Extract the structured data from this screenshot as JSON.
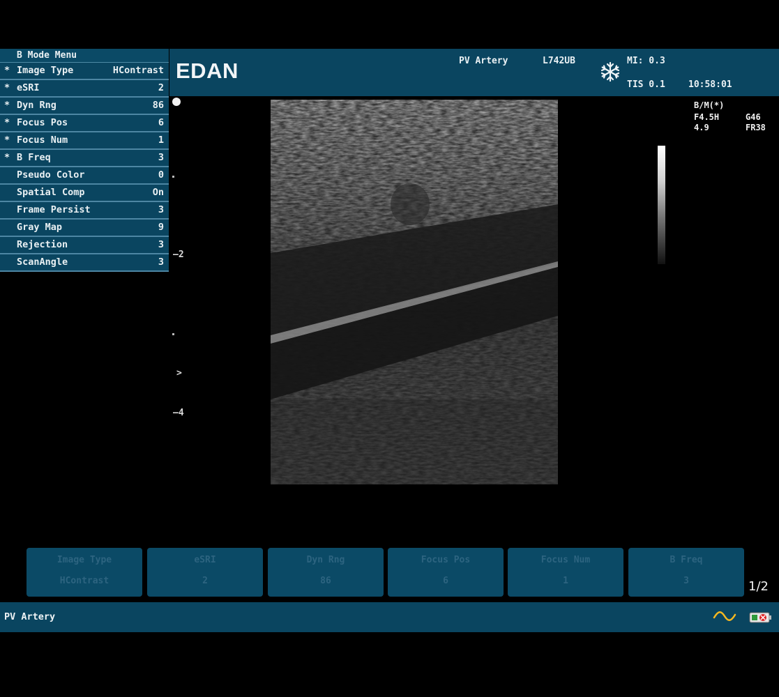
{
  "header": {
    "logo": "EDAN",
    "exam": "PV Artery",
    "probe": "L742UB",
    "mi": "MI: 0.3",
    "tis": "TIS 0.1",
    "time": "10:58:01",
    "freeze_icon": "snowflake-icon"
  },
  "menu": {
    "title": "B Mode Menu",
    "items": [
      {
        "star": "*",
        "label": "Image Type",
        "value": "HContrast"
      },
      {
        "star": "*",
        "label": "eSRI",
        "value": "2"
      },
      {
        "star": "*",
        "label": "Dyn Rng",
        "value": "86"
      },
      {
        "star": "*",
        "label": "Focus Pos",
        "value": "6"
      },
      {
        "star": "*",
        "label": "Focus Num",
        "value": "1"
      },
      {
        "star": "*",
        "label": "B Freq",
        "value": "3"
      },
      {
        "star": "",
        "label": "Pseudo Color",
        "value": "0"
      },
      {
        "star": "",
        "label": "Spatial Comp",
        "value": "On"
      },
      {
        "star": "",
        "label": "Frame Persist",
        "value": "3"
      },
      {
        "star": "",
        "label": "Gray Map",
        "value": "9"
      },
      {
        "star": "",
        "label": "Rejection",
        "value": "3"
      },
      {
        "star": "",
        "label": "ScanAngle",
        "value": "3"
      }
    ]
  },
  "depth_scale": {
    "tick_2": "—2",
    "tick_4": "—4",
    "focus_marker": ">"
  },
  "params": {
    "mode": "B/M(*)",
    "freq": "F4.5H",
    "gain": "G46",
    "depth": "4.9",
    "frame_rate": "FR38"
  },
  "softkeys": [
    {
      "name": "Image Type",
      "value": "HContrast"
    },
    {
      "name": "eSRI",
      "value": "2"
    },
    {
      "name": "Dyn Rng",
      "value": "86"
    },
    {
      "name": "Focus Pos",
      "value": "6"
    },
    {
      "name": "Focus Num",
      "value": "1"
    },
    {
      "name": "B Freq",
      "value": "3"
    }
  ],
  "page_indicator": "1/2",
  "status": {
    "exam": "PV Artery",
    "wave_icon": "waveform-icon",
    "battery_icon": "battery-icon"
  },
  "colors": {
    "panel": "#0a4560",
    "divider": "#4d86a3",
    "softkey_text": "#2d6480"
  }
}
